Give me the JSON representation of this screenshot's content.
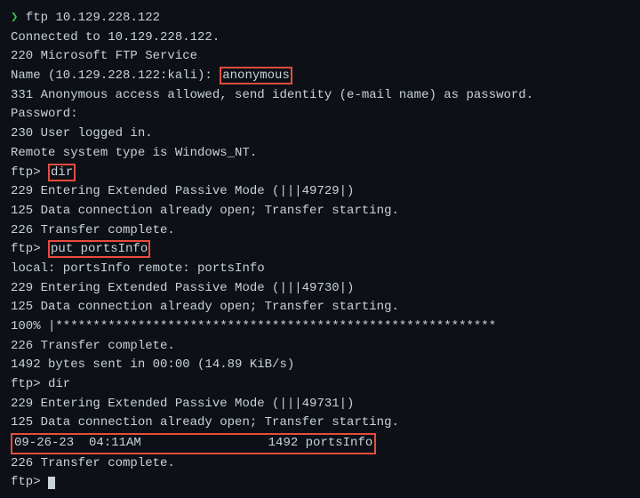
{
  "terminal": {
    "bg_color": "#0d1117",
    "text_color": "#c9d1d9",
    "green_color": "#3fb950",
    "red_color": "#e74c3c",
    "lines": [
      {
        "type": "command",
        "content": " ftp 10.129.228.122"
      },
      {
        "type": "output",
        "content": "Connected to 10.129.228.122."
      },
      {
        "type": "output",
        "content": "220 Microsoft FTP Service"
      },
      {
        "type": "output_highlight_inline",
        "prefix": "Name (10.129.228.122:kali): ",
        "highlight": "anonymous",
        "suffix": ""
      },
      {
        "type": "output",
        "content": "331 Anonymous access allowed, send identity (e-mail name) as password."
      },
      {
        "type": "output",
        "content": "Password:"
      },
      {
        "type": "output",
        "content": "230 User logged in."
      },
      {
        "type": "output",
        "content": "Remote system type is Windows_NT."
      },
      {
        "type": "command_inline",
        "prefix": "ftp> ",
        "highlight": "dir",
        "suffix": ""
      },
      {
        "type": "output",
        "content": "229 Entering Extended Passive Mode (|||49729|)"
      },
      {
        "type": "output",
        "content": "125 Data connection already open; Transfer starting."
      },
      {
        "type": "output",
        "content": "226 Transfer complete."
      },
      {
        "type": "command_inline",
        "prefix": "ftp> ",
        "highlight": "put portsInfo",
        "suffix": ""
      },
      {
        "type": "output",
        "content": "local: portsInfo remote: portsInfo"
      },
      {
        "type": "output",
        "content": "229 Entering Extended Passive Mode (|||49730|)"
      },
      {
        "type": "output",
        "content": "125 Data connection already open; Transfer starting."
      },
      {
        "type": "progress",
        "content": "100% |***********************************************************"
      },
      {
        "type": "output",
        "content": "226 Transfer complete."
      },
      {
        "type": "output",
        "content": "1492 bytes sent in 00:00 (14.89 KiB/s)"
      },
      {
        "type": "command_nobox",
        "content": "ftp> dir"
      },
      {
        "type": "output",
        "content": "229 Entering Extended Passive Mode (|||49731|)"
      },
      {
        "type": "output",
        "content": "125 Data connection already open; Transfer starting."
      },
      {
        "type": "dir_entry",
        "content": "09-26-23  04:11AM                 1492 portsInfo"
      },
      {
        "type": "output",
        "content": "226 Transfer complete."
      },
      {
        "type": "prompt_cursor",
        "content": "ftp> "
      }
    ]
  }
}
